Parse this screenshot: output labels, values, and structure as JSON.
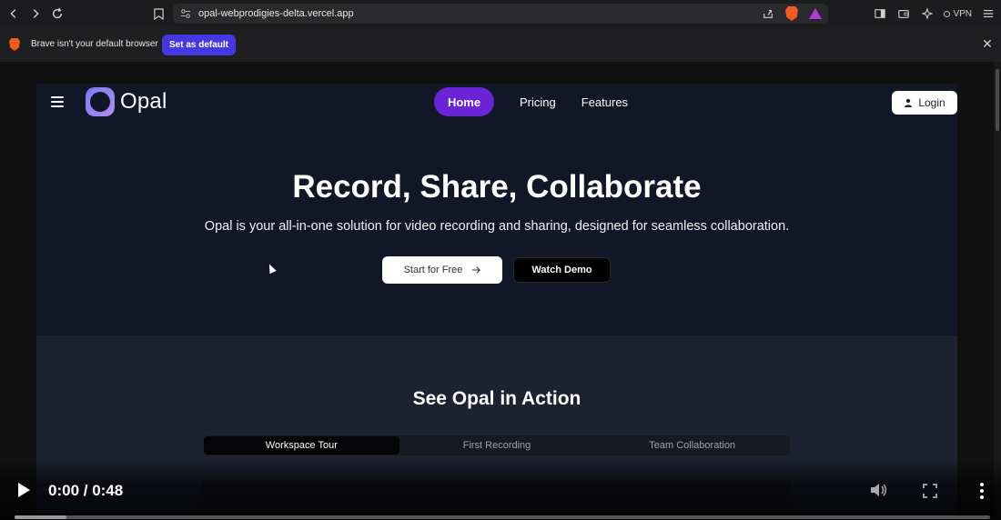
{
  "browser": {
    "url": "opal-webprodigies-delta.vercel.app",
    "vpn_label": "VPN",
    "icons": [
      "back-icon",
      "forward-icon",
      "reload-icon",
      "bookmark-icon",
      "site-settings-icon",
      "share-icon",
      "brave-shields-icon",
      "brave-rewards-icon",
      "sidebar-icon",
      "wallet-icon",
      "leo-ai-icon",
      "vpn-icon",
      "menu-icon"
    ]
  },
  "notification": {
    "text": "Brave isn't your default browser",
    "button_label": "Set as default"
  },
  "site": {
    "logo_text": "Opal",
    "nav": [
      {
        "label": "Home",
        "active": true
      },
      {
        "label": "Pricing",
        "active": false
      },
      {
        "label": "Features",
        "active": false
      }
    ],
    "login_label": "Login",
    "accent_color": "#6a24d6"
  },
  "hero": {
    "title": "Record, Share, Collaborate",
    "subtitle": "Opal is your all-in-one solution for video recording and sharing, designed for seamless collaboration.",
    "primary_cta": "Start for Free",
    "secondary_cta": "Watch Demo"
  },
  "action": {
    "title": "See Opal in Action",
    "tabs": [
      {
        "label": "Workspace Tour",
        "active": true
      },
      {
        "label": "First Recording",
        "active": false
      },
      {
        "label": "Team Collaboration",
        "active": false
      }
    ]
  },
  "video_player": {
    "time": "0:00 / 0:48",
    "progress_fraction": 0.053
  }
}
